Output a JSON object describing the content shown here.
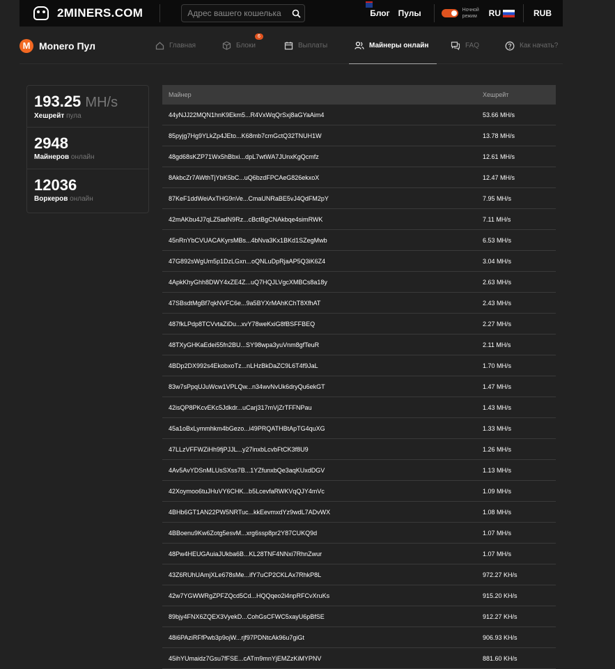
{
  "header": {
    "logo_text": "2MINERS.COM",
    "search_placeholder": "Адрес вашего кошелька",
    "blog": "Блог",
    "pools": "Пулы",
    "night_mode": "Ночной режим",
    "lang": "RU",
    "currency": "RUB"
  },
  "pool": {
    "name": "Monero Пул",
    "symbol": "M"
  },
  "tabs": [
    {
      "label": "Главная",
      "icon": "home-icon"
    },
    {
      "label": "Блоки",
      "icon": "cube-icon",
      "badge": "6"
    },
    {
      "label": "Выплаты",
      "icon": "calendar-icon"
    },
    {
      "label": "Майнеры онлайн",
      "icon": "users-icon"
    },
    {
      "label": "FAQ",
      "icon": "chat-icon"
    },
    {
      "label": "Как начать?",
      "icon": "help-icon"
    }
  ],
  "stats": {
    "hashrate": {
      "value": "193.25",
      "unit": "MH/s",
      "label": "Хешрейт",
      "sub": "пула"
    },
    "miners": {
      "value": "2948",
      "label": "Майнеров",
      "sub": "онлайн"
    },
    "workers": {
      "value": "12036",
      "label": "Воркеров",
      "sub": "онлайн"
    }
  },
  "table": {
    "columns": [
      "Майнер",
      "Хешрейт"
    ],
    "rows": [
      [
        "44yNJJ22MQN1hnK9Ekm5...R4VxWqQrSxj8aGYaAim4",
        "53.66 MH/s"
      ],
      [
        "85pyjg7Hg9YLkZp4JEto...K68mb7cmGctQ32TNUH1W",
        "13.78 MH/s"
      ],
      [
        "48gd68sKZP71Wx5hBbxi...dpL7wtWA7JUnxKgQcmfz",
        "12.61 MH/s"
      ],
      [
        "8AkbcZr7AWthTjYbK5bC...uQ6bzdFPCAeG826ekxoX",
        "12.47 MH/s"
      ],
      [
        "87KeF1ddWeiAxTHG9nVe...CmaUNRaBE5vJ4QdFM2pY",
        "7.95 MH/s"
      ],
      [
        "42mAKbu4J7qLZ5adN9Rz...cBctBgCNAkbqe4simRWK",
        "7.11 MH/s"
      ],
      [
        "45nRnYbCVUACAKyrsMBs...4bNva3Kx1BKd1SZegMwb",
        "6.53 MH/s"
      ],
      [
        "47G892sWgUm5p1DzLGxn...oQNLuDpRjaAP5Q3iK6Z4",
        "3.04 MH/s"
      ],
      [
        "4ApkKhyGhh8DWY4xZE4Z...uQ7HQJLVgcXMBCs8a18y",
        "2.63 MH/s"
      ],
      [
        "47SBsdtMgBf7qkNVFC6e...9a5BYXrMAhKChT8XfhAT",
        "2.43 MH/s"
      ],
      [
        "487fkLPdp8TCVvtaZiDu...xvY78weKxiG8fBSFFBEQ",
        "2.27 MH/s"
      ],
      [
        "48TXyGHKaEdei55fn2BU...SY98wpa3yuVnm8gfTeuR",
        "2.11 MH/s"
      ],
      [
        "4BDp2DX992s4EkobxoTz...nLHzBkDaZC9L6T4f9JaL",
        "1.70 MH/s"
      ],
      [
        "83w7sPpqUJuWcw1VPLQw...n34wvNvUk6dryQu6ekGT",
        "1.47 MH/s"
      ],
      [
        "42isQP8PKcvEKc5Jdkdr...uCarj317mVjZrTFFNPau",
        "1.43 MH/s"
      ],
      [
        "45a1oBxLymmhkm4bGezo...i49PRQATHBtApTG4quXG",
        "1.33 MH/s"
      ],
      [
        "47LLzVFFWZiHh9fjPJJL...y27inxbLcvbFtCK3f8U9",
        "1.26 MH/s"
      ],
      [
        "4Av5AvYDSnMLUsSXss7B...1YZfunxbQe3aqKUxdDGV",
        "1.13 MH/s"
      ],
      [
        "42Xoymoo6tuJHuVY6CHK...b5LcevfaRWKVqQJY4mVc",
        "1.09 MH/s"
      ],
      [
        "4BHb6GT1AN22PW5NRTuc...kkEevmxdYz9wdL7ADvWX",
        "1.08 MH/s"
      ],
      [
        "4BBoenu9Kw6Zotg5esvM...xrg6ssp8pr2Y87CUKQ9d",
        "1.07 MH/s"
      ],
      [
        "48Pw4HEUGAuiaJUkba6B...KL28TNF4NNxi7RhnZwur",
        "1.07 MH/s"
      ],
      [
        "43Z6RUhUAmjXLe678sMe...ifY7uCP2CKLAx7RhkP8L",
        "972.27 KH/s"
      ],
      [
        "42w7YGWWRgZPFZQcd5Cd...HQQqeo2i4npRFCvXruKs",
        "915.20 KH/s"
      ],
      [
        "89bjy4FNX6ZQEX3VyekD...CohGsCFWC5xayU6pBfSE",
        "912.27 KH/s"
      ],
      [
        "48i6PAziRFfPwb3p9ojW...rjf97PDNtcAk96u7giGt",
        "906.93 KH/s"
      ],
      [
        "45ihYUmaidz7Gsu7fFSE...cATm9mnYjEMZzKiMYPNV",
        "881.60 KH/s"
      ]
    ]
  }
}
